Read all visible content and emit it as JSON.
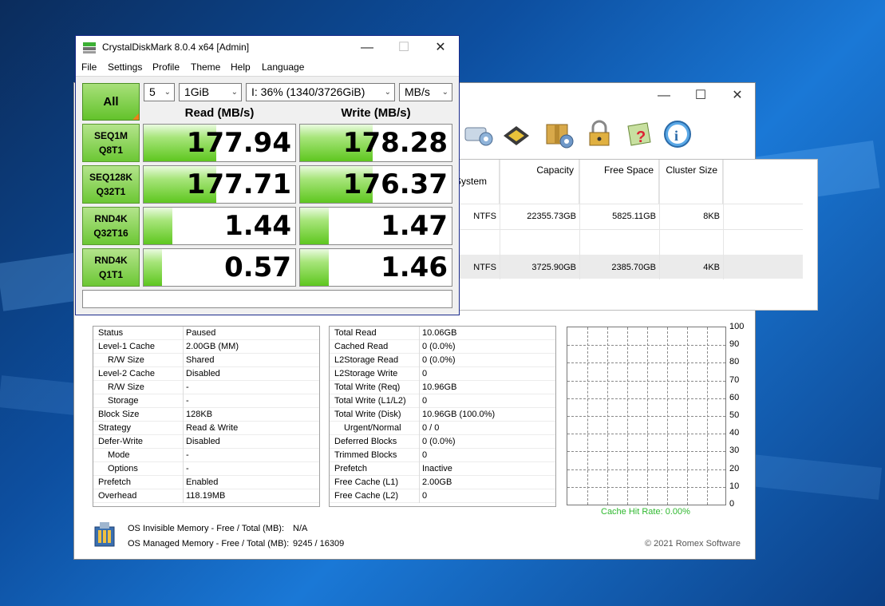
{
  "cdm": {
    "title": "CrystalDiskMark 8.0.4 x64 [Admin]",
    "menu": [
      "File",
      "Settings",
      "Profile",
      "Theme",
      "Help",
      "Language"
    ],
    "all_label": "All",
    "count": "5",
    "size": "1GiB",
    "drive": "I: 36% (1340/3726GiB)",
    "unit": "MB/s",
    "read_header": "Read (MB/s)",
    "write_header": "Write (MB/s)",
    "tests": [
      {
        "line1": "SEQ1M",
        "line2": "Q8T1",
        "read": "177.94",
        "write": "178.28",
        "read_level": 0.48,
        "write_level": 0.48
      },
      {
        "line1": "SEQ128K",
        "line2": "Q32T1",
        "read": "177.71",
        "write": "176.37",
        "read_level": 0.48,
        "write_level": 0.48
      },
      {
        "line1": "RND4K",
        "line2": "Q32T16",
        "read": "1.44",
        "write": "1.47",
        "read_level": 0.19,
        "write_level": 0.19
      },
      {
        "line1": "RND4K",
        "line2": "Q1T1",
        "read": "0.57",
        "write": "1.46",
        "read_level": 0.12,
        "write_level": 0.19
      }
    ]
  },
  "primo": {
    "drive_table": {
      "headers": [
        "e System",
        "Capacity",
        "Free Space",
        "Cluster Size"
      ],
      "rows": [
        {
          "fs": "NTFS",
          "capacity": "22355.73GB",
          "free": "5825.11GB",
          "cluster": "8KB"
        },
        {
          "fs": "NTFS",
          "capacity": "3725.90GB",
          "free": "2385.70GB",
          "cluster": "4KB"
        }
      ]
    },
    "left_stats": [
      {
        "k": "Status",
        "v": "Paused",
        "indent": false
      },
      {
        "k": "Level-1 Cache",
        "v": "2.00GB (MM)",
        "indent": false
      },
      {
        "k": "R/W Size",
        "v": "Shared",
        "indent": true
      },
      {
        "k": "Level-2 Cache",
        "v": "Disabled",
        "indent": false
      },
      {
        "k": "R/W Size",
        "v": "-",
        "indent": true
      },
      {
        "k": "Storage",
        "v": "-",
        "indent": true
      },
      {
        "k": "Block Size",
        "v": "128KB",
        "indent": false
      },
      {
        "k": "Strategy",
        "v": "Read & Write",
        "indent": false
      },
      {
        "k": "Defer-Write",
        "v": "Disabled",
        "indent": false
      },
      {
        "k": "Mode",
        "v": "-",
        "indent": true
      },
      {
        "k": "Options",
        "v": "-",
        "indent": true
      },
      {
        "k": "Prefetch",
        "v": "Enabled",
        "indent": false
      },
      {
        "k": "Overhead",
        "v": "118.19MB",
        "indent": false
      }
    ],
    "right_stats": [
      {
        "k": "Total Read",
        "v": "10.06GB",
        "indent": false
      },
      {
        "k": "Cached Read",
        "v": "0 (0.0%)",
        "indent": false
      },
      {
        "k": "L2Storage Read",
        "v": "0 (0.0%)",
        "indent": false
      },
      {
        "k": "L2Storage Write",
        "v": "0",
        "indent": false
      },
      {
        "k": "Total Write (Req)",
        "v": "10.96GB",
        "indent": false
      },
      {
        "k": "Total Write (L1/L2)",
        "v": "0",
        "indent": false
      },
      {
        "k": "Total Write (Disk)",
        "v": "10.96GB (100.0%)",
        "indent": false
      },
      {
        "k": "Urgent/Normal",
        "v": "0 / 0",
        "indent": true
      },
      {
        "k": "Deferred Blocks",
        "v": "0 (0.0%)",
        "indent": false
      },
      {
        "k": "Trimmed Blocks",
        "v": "0",
        "indent": false
      },
      {
        "k": "Prefetch",
        "v": "Inactive",
        "indent": false
      },
      {
        "k": "Free Cache (L1)",
        "v": "2.00GB",
        "indent": false
      },
      {
        "k": "Free Cache (L2)",
        "v": "0",
        "indent": false
      }
    ],
    "chart_ticks": [
      "100",
      "90",
      "80",
      "70",
      "60",
      "50",
      "40",
      "30",
      "20",
      "10",
      "0"
    ],
    "hit_rate": "Cache Hit Rate: 0.00%",
    "mem_invisible_label": "OS Invisible Memory - Free / Total (MB):",
    "mem_invisible_value": "N/A",
    "mem_managed_label": "OS Managed Memory - Free / Total (MB):",
    "mem_managed_value": "9245 / 16309",
    "copyright": "© 2021 Romex Software",
    "toolbar_icons": [
      "drive-settings-icon",
      "chip-icon",
      "package-gear-icon",
      "lock-key-icon",
      "help-book-icon",
      "info-icon"
    ]
  }
}
